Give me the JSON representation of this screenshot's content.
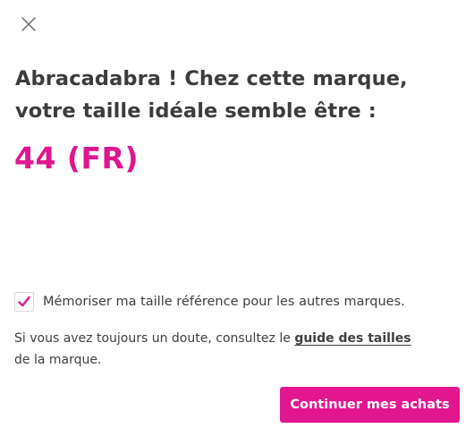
{
  "close": {
    "icon": "close-icon"
  },
  "result": {
    "headline_line1": "Abracadabra ! Chez cette marque,",
    "headline_line2": "votre taille idéale semble être :",
    "size": "44 (FR)"
  },
  "remember": {
    "checked": true,
    "label": "Mémoriser ma taille référence pour les autres marques."
  },
  "help": {
    "text_before": "Si vous avez toujours un doute, consultez le ",
    "link_label": "guide des tailles",
    "text_after": " de la marque."
  },
  "actions": {
    "continue_label": "Continuer mes achats"
  },
  "colors": {
    "accent": "#e2168f",
    "text": "#3f3f3f"
  }
}
